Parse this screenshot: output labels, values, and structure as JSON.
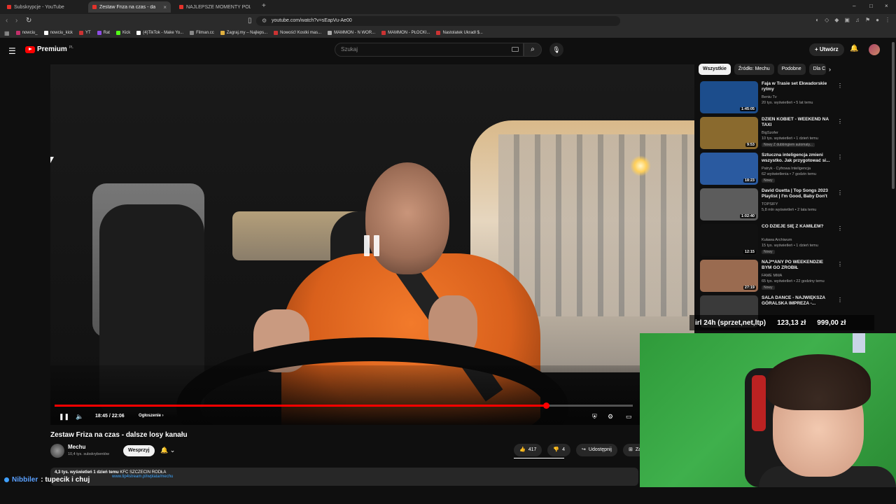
{
  "browser": {
    "tabs": [
      {
        "title": "Subskrypcje - YouTube"
      },
      {
        "title": "Zestaw Friza na czas - dalsze"
      },
      {
        "title": "NAJLEPSZE MOMENTY POLSKIEGO"
      }
    ],
    "url": "youtube.com/watch?v=sEapVu-Ae00",
    "bookmarks": [
      "nowciu_",
      "nowciu_kick",
      "YT",
      "Rat",
      "Kick",
      "(4)TikTok - Make Yo...",
      "Filman.cc",
      "Zagraj.my – Najleps...",
      "Nowość! Kostki mas...",
      "MAMMON - N WOR...",
      "MAMMON - PŁOCKI...",
      "Nastolatek Ukradł $..."
    ]
  },
  "header": {
    "logo": "Premium",
    "region": "PL",
    "search_placeholder": "Szukaj",
    "create_label": "Utwórz"
  },
  "player": {
    "time": "18:45 / 22:06",
    "ad_label": "Ogłoszenie",
    "progress": 0.85
  },
  "video": {
    "title": "Zestaw Friza na czas - dalsze losy kanału",
    "channel": "Mechu",
    "subscribers": "10,4 tys. subskrybentów",
    "support_label": "Wesprzyj",
    "likes": "417",
    "dislikes": "4",
    "share_label": "Udostępnij",
    "save_label": "Zapis",
    "views": "4,3 tys. wyświetleń",
    "date": "1 dzień temu",
    "desc_text": "KFC SZCZECIN RODŁA",
    "desc_link": "www.tip4stream.pl/wplata/mechu"
  },
  "sidebar": {
    "chips": [
      "Wszystkie",
      "Źródło: Mechu",
      "Podobne",
      "Dla C"
    ],
    "recs": [
      {
        "title": "Faja w Trasie set Ekwadorskie rytmy",
        "channel": "Beniu Tv",
        "meta": "20 tys. wyświetleń • 5 lat temu",
        "duration": "1:45:05",
        "badge": "",
        "color": "#1c4d8c"
      },
      {
        "title": "DZIEŃ KOBIET - WEEKEND NA TAXI",
        "channel": "BigSzofer",
        "meta": "10 tys. wyświetleń • 1 dzień temu",
        "duration": "9:53",
        "badge": "Nowy  Z dubbingiem automaty...",
        "color": "#8a6a2e"
      },
      {
        "title": "Sztuczna inteligencja zmieni wszystko. Jak przygotować si...",
        "channel": "Patryk - Cyfrowa Inteligencja",
        "meta": "62 wyświetlenia • 7 godzin temu",
        "duration": "18:23",
        "badge": "Nowy",
        "color": "#2a5aa0"
      },
      {
        "title": "David Guetta | Top Songs 2023 Playlist | I'm Good, Baby Don't ...",
        "channel": "TOPSIFY",
        "meta": "5,8 mln wyświetleń • 2 lata temu",
        "duration": "1:02:40",
        "badge": "",
        "color": "#5c5c5c"
      },
      {
        "title": "CO DZIEJE SIĘ Z KAMILEM?",
        "channel": "Kuława Archiwum",
        "meta": "15 tys. wyświetleń • 1 dzień temu",
        "duration": "12:15",
        "badge": "Nowy",
        "color": "#111111"
      },
      {
        "title": "NAJ**ANY PO WEEKENDZIE BYM GO ZROBIŁ",
        "channel": "FAME MMA",
        "meta": "65 tys. wyświetleń • 22 godziny temu",
        "duration": "27:19",
        "badge": "Nowy",
        "color": "#9a6b50"
      },
      {
        "title": "SALA DANCE - NAJWIĘKSZA GÓRALSKA IMPREZA -...",
        "channel": "",
        "meta": "",
        "duration": "",
        "badge": "",
        "color": "#3a3a3a"
      }
    ]
  },
  "overlay": {
    "donation_label": "irl 24h (sprzet,net,ltp)",
    "amount1": "123,13 zł",
    "amount2": "999,00 zł",
    "chat_user": "Nibbiler",
    "chat_msg": ": tupecik i chuj"
  }
}
